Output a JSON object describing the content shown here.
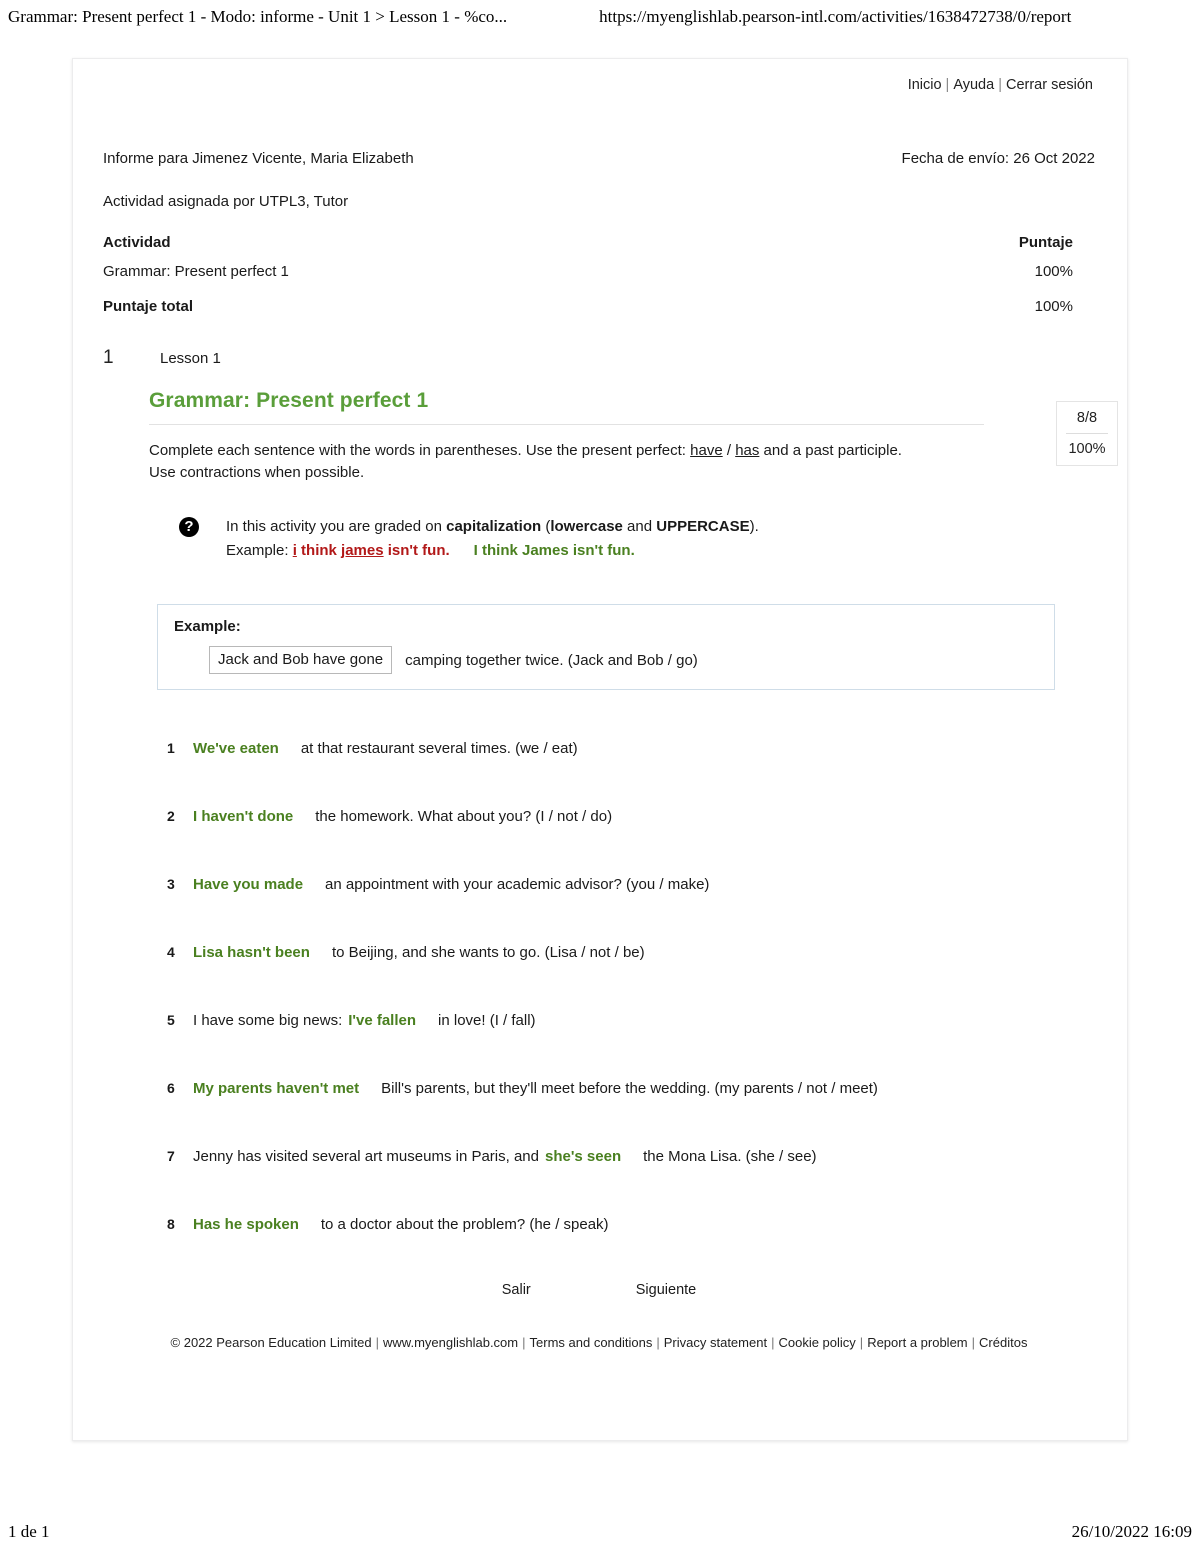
{
  "browser": {
    "header_title": "Grammar: Present perfect 1 - Modo: informe - Unit 1 > Lesson 1 - %co...",
    "header_url": "https://myenglishlab.pearson-intl.com/activities/1638472738/0/report",
    "footer_page": "1 de 1",
    "footer_timestamp": "26/10/2022 16:09"
  },
  "topnav": {
    "home": "Inicio",
    "help": "Ayuda",
    "logout": "Cerrar sesión",
    "separator": "|"
  },
  "report": {
    "student_line": "Informe para Jimenez Vicente, Maria Elizabeth",
    "submitted_line": "Fecha de envío: 26 Oct 2022",
    "assigned_line": "Actividad asignada por UTPL3, Tutor",
    "col_activity": "Actividad",
    "col_score": "Puntaje",
    "activity_name": "Grammar: Present perfect 1",
    "activity_score": "100%",
    "total_label": "Puntaje total",
    "total_score": "100%"
  },
  "lesson": {
    "number": "1",
    "label": "Lesson 1"
  },
  "activity": {
    "title": "Grammar: Present perfect 1",
    "description_part1": "Complete each sentence with the words in parentheses. Use the present perfect: ",
    "description_have": "have",
    "description_slash": " / ",
    "description_has": "has",
    "description_part2": " and a past participle. Use contractions when possible.",
    "score_fraction": "8/8",
    "score_percent": "100%"
  },
  "note": {
    "icon": "question-mark-icon",
    "icon_glyph": "?",
    "line1_part1": "In this activity you are graded on ",
    "line1_bold1": "capitalization",
    "line1_part2": " (",
    "line1_bold2": "lowercase",
    "line1_part3": " and ",
    "line1_bold3": "UPPERCASE",
    "line1_part4": ").",
    "example_label": "Example: ",
    "wrong_i": "i",
    "wrong_think": " think ",
    "wrong_james": "james",
    "wrong_rest": " isn't fun.",
    "right_text": "I think James isn't fun.",
    "color_wrong": "#b21818",
    "color_right": "#4a8020"
  },
  "example": {
    "title": "Example:",
    "input_value": "Jack and Bob have gone",
    "after_text": "camping together twice. (Jack and Bob / go)"
  },
  "items": [
    {
      "number": "1",
      "pre": "",
      "answer": "We've eaten",
      "post": "at that restaurant several times. (we / eat)"
    },
    {
      "number": "2",
      "pre": "",
      "answer": "I haven't done",
      "post": "the homework. What about you? (I / not / do)"
    },
    {
      "number": "3",
      "pre": "",
      "answer": "Have you made",
      "post": "an appointment with your academic advisor? (you / make)"
    },
    {
      "number": "4",
      "pre": "",
      "answer": "Lisa hasn't been",
      "post": "to Beijing, and she wants to go. (Lisa / not / be)"
    },
    {
      "number": "5",
      "pre": "I have some big news:",
      "answer": "I've fallen",
      "post": "in love! (I / fall)"
    },
    {
      "number": "6",
      "pre": "",
      "answer": "My parents haven't met",
      "post": "Bill's parents, but they'll meet before the wedding. (my parents / not / meet)"
    },
    {
      "number": "7",
      "pre": "Jenny has visited several art museums in Paris, and",
      "answer": "she's seen",
      "post": "the Mona Lisa. (she / see)"
    },
    {
      "number": "8",
      "pre": "",
      "answer": "Has he spoken",
      "post": "to a doctor about the problem? (he / speak)"
    }
  ],
  "nav": {
    "exit": "Salir",
    "next": "Siguiente"
  },
  "footer": {
    "copyright": "© 2022 Pearson Education Limited",
    "website": "www.myenglishlab.com",
    "terms": "Terms and conditions",
    "privacy": "Privacy statement",
    "cookie": "Cookie policy",
    "report": "Report a problem",
    "credits": "Créditos",
    "separator": "|"
  },
  "theme": {
    "heading_green": "#5a9e3a",
    "answer_green": "#4a8020",
    "wrong_red": "#b21818"
  }
}
